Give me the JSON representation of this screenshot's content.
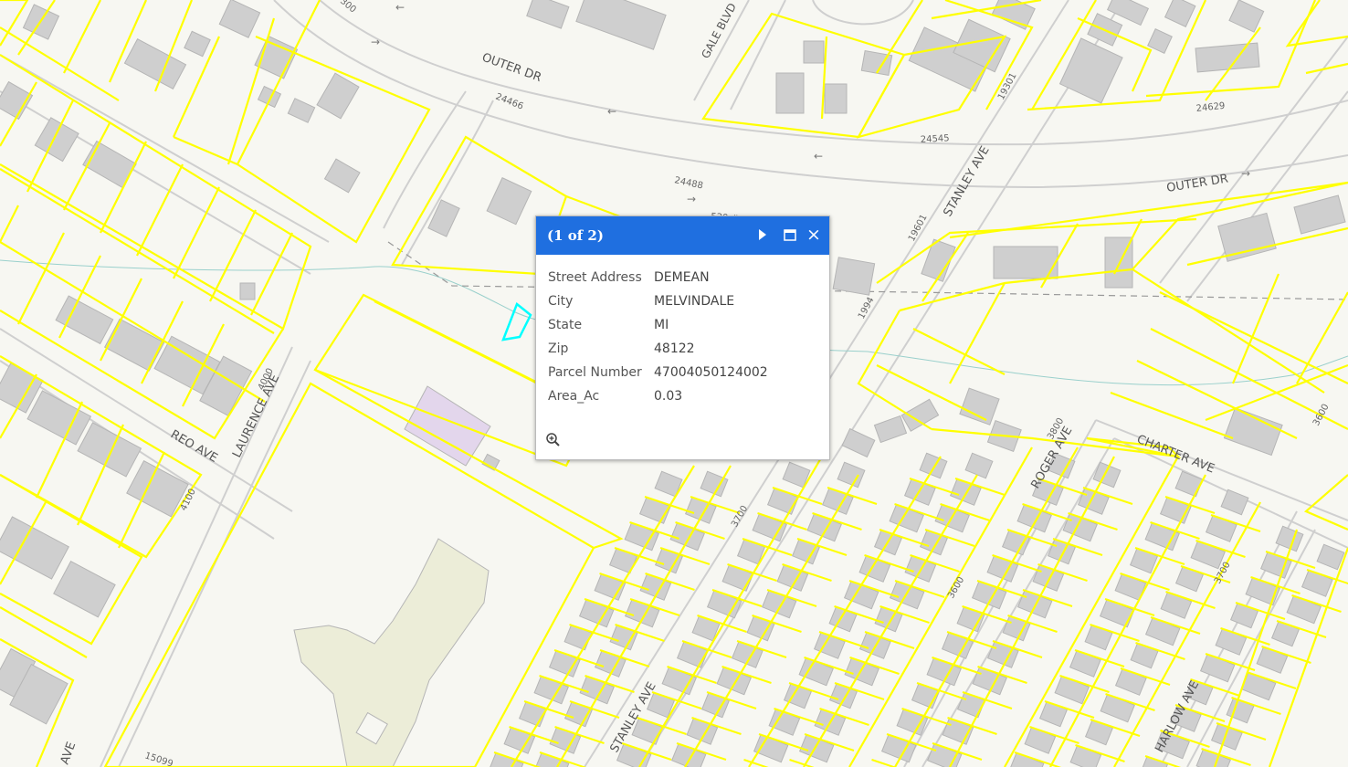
{
  "map": {
    "street_labels": {
      "outer_dr_west": "OUTER DR",
      "outer_dr_east": "OUTER DR",
      "gale_blvd": "GALE BLVD",
      "stanley_ave_north": "STANLEY AVE",
      "stanley_ave_south": "STANLEY AVE",
      "reo_ave": "REO AVE",
      "laurence_ave": "LAURENCE AVE",
      "roger_ave": "ROGER AVE",
      "charter_ave": "CHARTER AVE",
      "harlow_ave": "HARLOW AVE",
      "ave_bottom_left": "AVE"
    },
    "address_numbers": {
      "n24466": "24466",
      "n24545": "24545",
      "n24488": "24488",
      "n24629": "24629",
      "n19301": "19301",
      "n19601": "19601",
      "n19941": "1994",
      "n4000": "4000",
      "n4100": "4100",
      "n3700a": "3700",
      "n3600": "3600",
      "n3800": "3800",
      "n3700b": "3700",
      "n3600b": "3600",
      "n15099": "15099",
      "n520": "520 #",
      "n300": "300"
    },
    "colors": {
      "parcel": "#ffff00",
      "selected_parcel": "#00ffff",
      "building": "#cfcfcf",
      "school_building": "#ecedd8",
      "purple_building": "#e3d6ec",
      "road_edge": "#cfcfcf",
      "creek": "#9ad0cc"
    }
  },
  "popup": {
    "title": "(1 of 2)",
    "next_icon": "next-arrow-icon",
    "maximize_icon": "maximize-icon",
    "close_label": "×",
    "fields": [
      {
        "key": "Street Address",
        "value": "DEMEAN"
      },
      {
        "key": "City",
        "value": "MELVINDALE"
      },
      {
        "key": "State",
        "value": "MI"
      },
      {
        "key": "Zip",
        "value": "48122"
      },
      {
        "key": "Parcel Number",
        "value": "47004050124002"
      },
      {
        "key": "Area_Ac",
        "value": "0.03"
      }
    ],
    "zoom_icon": "zoom-to-icon"
  }
}
